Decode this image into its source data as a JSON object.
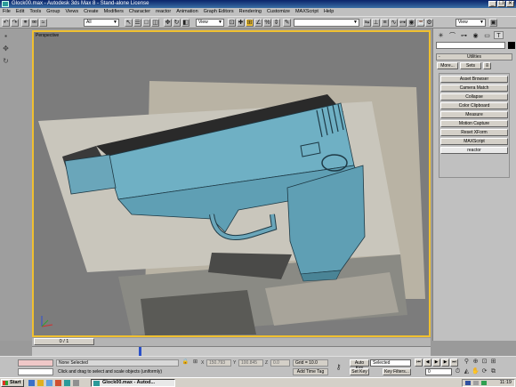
{
  "window": {
    "title": "Glock00.max - Autodesk 3ds Max 8 - Stand-alone License",
    "minimize_glyph": "_",
    "restore_glyph": "❐",
    "close_glyph": "✕"
  },
  "menu": [
    "File",
    "Edit",
    "Tools",
    "Group",
    "Views",
    "Create",
    "Modifiers",
    "Character",
    "reactor",
    "Animation",
    "Graph Editors",
    "Rendering",
    "Customize",
    "MAXScript",
    "Help"
  ],
  "toolbar": {
    "selection_filter": "All",
    "reference_coord": "View",
    "named_selection": "",
    "render_view": "View"
  },
  "viewport": {
    "label": "Perspective"
  },
  "command_panel": {
    "tabs": [
      "create-icon",
      "modify-icon",
      "hierarchy-icon",
      "motion-icon",
      "display-icon",
      "utilities-icon"
    ],
    "active_tab": "utilities-icon",
    "rollout_title": "Utilities",
    "rollout_sign": "-",
    "more_label": "More...",
    "sets_label": "Sets",
    "utilities": [
      "Asset Browser",
      "Camera Match",
      "Collapse",
      "Color Clipboard",
      "Measure",
      "Motion Capture",
      "Reset XForm",
      "MAXScript",
      "reactor"
    ],
    "active_utility": "reactor"
  },
  "time_slider": {
    "label": "0 / 1"
  },
  "status": {
    "selection": "None Selected",
    "prompt": "Click and drag to select and scale objects (uniformly)",
    "x_label": "X",
    "x_value": "150.793",
    "y_label": "Y",
    "y_value": "100.845",
    "z_label": "Z",
    "z_value": "0.0",
    "grid": "Grid = 10.0",
    "add_time_tag": "Add Time Tag",
    "auto_key": "Auto Key",
    "set_key": "Set Key",
    "key_mode": "Selected",
    "key_filters": "Key Filters...",
    "current_frame": "0"
  },
  "taskbar": {
    "start_label": "Start",
    "task_label": "Glock00.max - Autod...",
    "clock": "11:19"
  }
}
